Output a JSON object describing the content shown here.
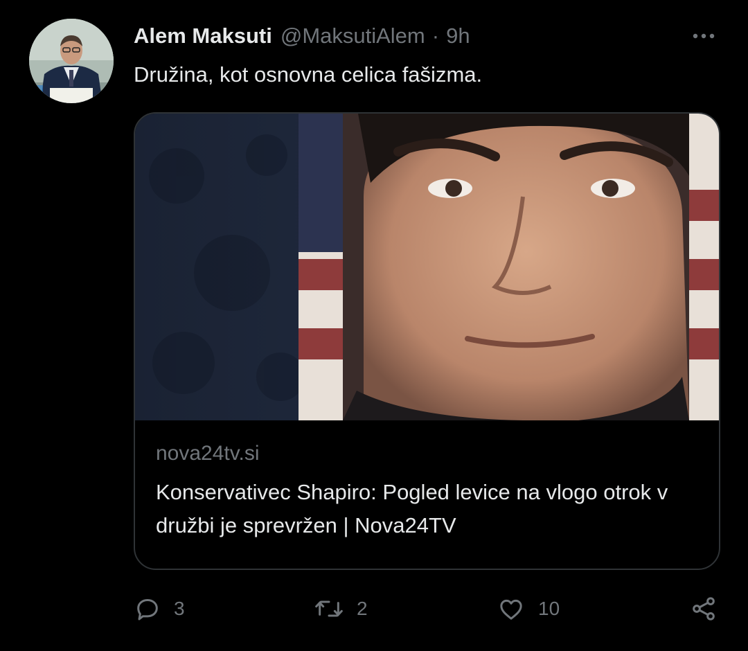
{
  "tweet": {
    "author_name": "Alem Maksuti",
    "handle": "@MaksutiAlem",
    "separator": "·",
    "time": "9h",
    "text": "Družina, kot osnovna celica fašizma."
  },
  "card": {
    "domain": "nova24tv.si",
    "title": "Konservativec Shapiro: Pogled levice na vlogo otrok v družbi je sprevržen | Nova24TV"
  },
  "actions": {
    "reply_count": "3",
    "retweet_count": "2",
    "like_count": "10"
  },
  "icons": {
    "more": "more-horizontal-icon",
    "reply": "comment-bubble-icon",
    "retweet": "retweet-arrows-icon",
    "like": "heart-icon",
    "share": "share-nodes-icon"
  },
  "colors": {
    "background": "#000000",
    "text_primary": "#e7e9ea",
    "text_secondary": "#71767b",
    "border": "#2f3336"
  }
}
